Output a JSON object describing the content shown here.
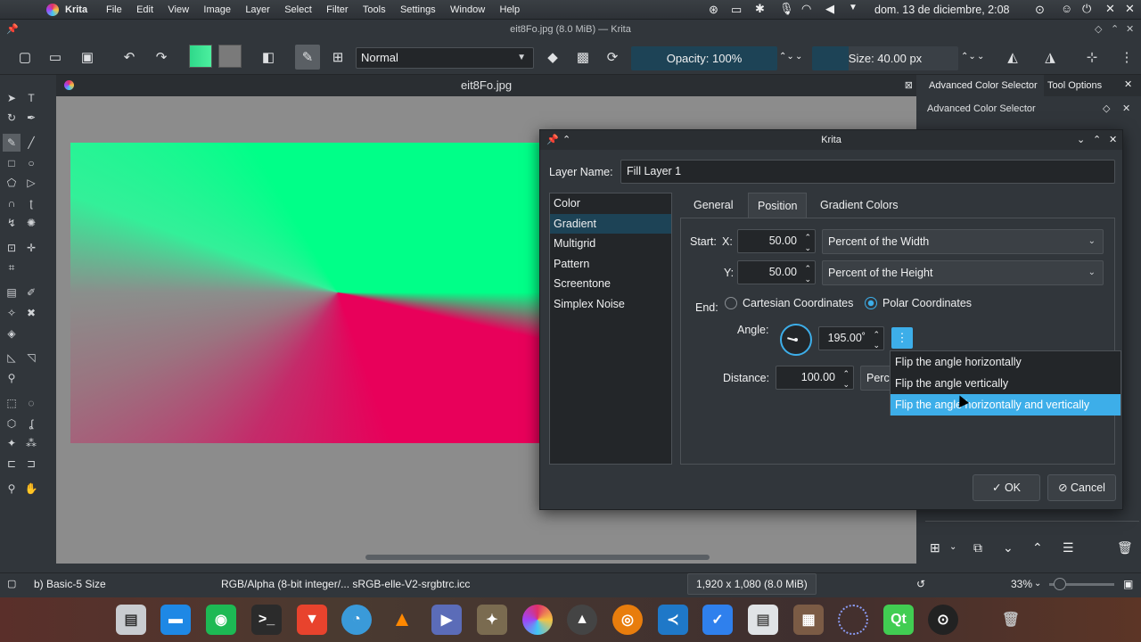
{
  "topbar": {
    "app_name": "Krita",
    "menus": [
      "File",
      "Edit",
      "View",
      "Image",
      "Layer",
      "Select",
      "Filter",
      "Tools",
      "Settings",
      "Window",
      "Help"
    ],
    "clock": "dom. 13 de diciembre,  2:08"
  },
  "window": {
    "title": "eit8Fo.jpg (8.0 MiB) — Krita"
  },
  "toolbar": {
    "blend_mode": "Normal",
    "opacity": "Opacity: 100%",
    "size": "Size: 40.00 px"
  },
  "canvas": {
    "tab_title": "eit8Fo.jpg"
  },
  "dock": {
    "tab1": "Advanced Color Selector",
    "tab2": "Tool Options",
    "panel_title": "Advanced Color Selector"
  },
  "dialog": {
    "title": "Krita",
    "layer_name_label": "Layer Name:",
    "layer_name_value": "Fill Layer 1",
    "types": [
      "Color",
      "Gradient",
      "Multigrid",
      "Pattern",
      "Screentone",
      "Simplex Noise"
    ],
    "selected_type": "Gradient",
    "tabs": [
      "General",
      "Position",
      "Gradient Colors"
    ],
    "active_tab": "Position",
    "start_label": "Start:",
    "x_label": "X:",
    "x_value": "50.00",
    "x_unit": "Percent of the Width",
    "y_label": "Y:",
    "y_value": "50.00",
    "y_unit": "Percent of the Height",
    "end_label": "End:",
    "cartesian_label": "Cartesian Coordinates",
    "polar_label": "Polar Coordinates",
    "angle_label": "Angle:",
    "angle_value": "195.00˚",
    "distance_label": "Distance:",
    "distance_value": "100.00",
    "distance_unit": "Perce",
    "ok_label": "OK",
    "cancel_label": "Cancel"
  },
  "flip_menu": [
    "Flip the angle horizontally",
    "Flip the angle vertically",
    "Flip the angle horizontally and vertically"
  ],
  "statusbar": {
    "brush": "b) Basic-5 Size",
    "color_space": "RGB/Alpha (8-bit integer/... sRGB-elle-V2-srgbtrc.icc",
    "dimensions": "1,920 x 1,080 (8.0 MiB)",
    "zoom": "33%"
  },
  "colors": {
    "accent": "#3daee9",
    "fg_swatch": "#3ee89a",
    "gradient_green": "#00ff88",
    "gradient_pink": "#e8005a"
  }
}
